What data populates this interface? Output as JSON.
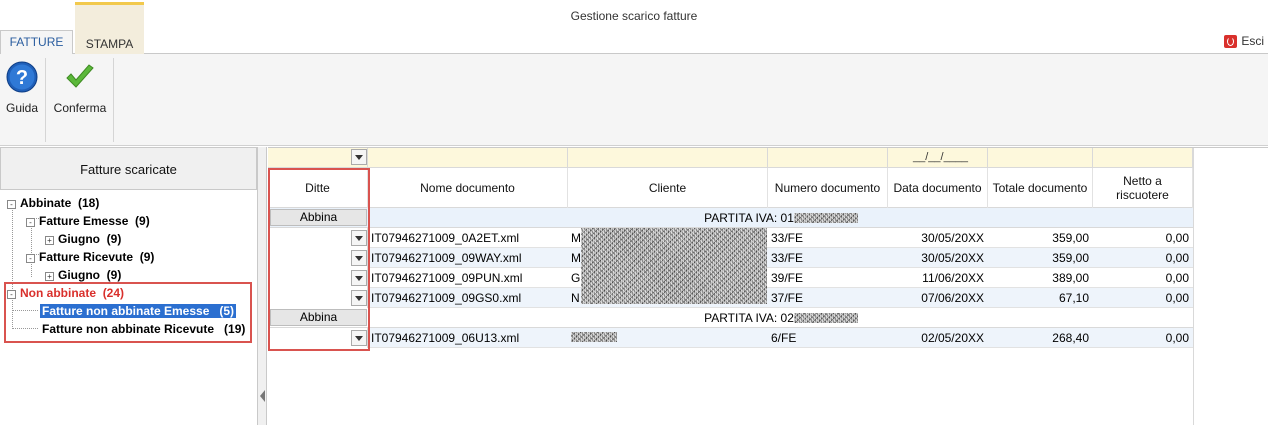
{
  "window": {
    "title": "Gestione scarico fatture"
  },
  "tabs": {
    "fatture": "FATTURE",
    "stampa": "STAMPA",
    "esci": "Esci"
  },
  "ribbon": {
    "guida": "Guida",
    "conferma": "Conferma"
  },
  "left": {
    "header": "Fatture scaricate",
    "tree": {
      "abbinate": "Abbinate",
      "abbinate_count": "(18)",
      "emesse": "Fatture Emesse",
      "emesse_count": "(9)",
      "giugno1": "Giugno",
      "giugno1_count": "(9)",
      "ricevute": "Fatture Ricevute",
      "ricevute_count": "(9)",
      "giugno2": "Giugno",
      "giugno2_count": "(9)",
      "non_abbinate": "Non abbinate",
      "non_abbinate_count": "(24)",
      "nae": "Fatture non abbinate Emesse",
      "nae_count": "(5)",
      "nar": "Fatture non abbinate Ricevute",
      "nar_count": "(19)",
      "expand_minus": "-",
      "expand_plus": "+"
    }
  },
  "grid": {
    "date_mask": "__/__/____",
    "headers": {
      "ditte": "Ditte",
      "nome": "Nome documento",
      "cliente": "Cliente",
      "numero": "Numero documento",
      "data": "Data documento",
      "totale": "Totale documento",
      "netto": "Netto a riscuotere"
    },
    "group1": {
      "button": "Abbina",
      "label": "PARTITA IVA: 01"
    },
    "group2": {
      "button": "Abbina",
      "label": "PARTITA IVA: 02"
    },
    "rows": [
      {
        "nome": "IT07946271009_0A2ET.xml",
        "cliente": "M",
        "numero": "33/FE",
        "data": "30/05/20XX",
        "totale": "359,00",
        "netto": "0,00"
      },
      {
        "nome": "IT07946271009_09WAY.xml",
        "cliente": "M",
        "numero": "33/FE",
        "data": "30/05/20XX",
        "totale": "359,00",
        "netto": "0,00"
      },
      {
        "nome": "IT07946271009_09PUN.xml",
        "cliente": "G",
        "numero": "39/FE",
        "data": "11/06/20XX",
        "totale": "389,00",
        "netto": "0,00"
      },
      {
        "nome": "IT07946271009_09GS0.xml",
        "cliente": "N",
        "numero": "37/FE",
        "data": "07/06/20XX",
        "totale": "67,10",
        "netto": "0,00"
      },
      {
        "nome": "IT07946271009_06U13.xml",
        "cliente": "",
        "numero": "6/FE",
        "data": "02/05/20XX",
        "totale": "268,40",
        "netto": "0,00"
      }
    ]
  }
}
